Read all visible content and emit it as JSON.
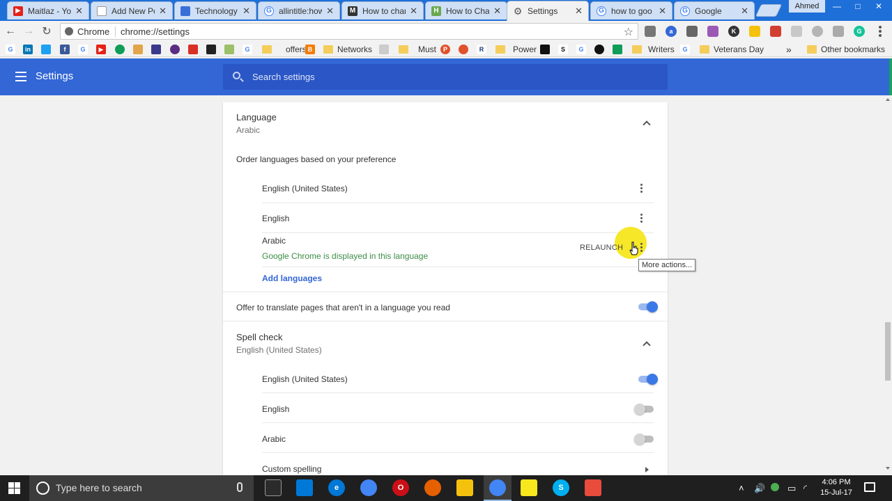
{
  "tabs": [
    {
      "title": "Maitlaz - Yo",
      "icon": "youtube-icon",
      "color": "#e62117"
    },
    {
      "title": "Add New Po",
      "icon": "page-icon",
      "color": "#9e9e9e"
    },
    {
      "title": "Technology",
      "icon": "blog-icon",
      "color": "#3a6fd8"
    },
    {
      "title": "allintitle:how",
      "icon": "google-icon",
      "color": "#4285f4"
    },
    {
      "title": "How to chan",
      "icon": "medium-icon",
      "color": "#333333"
    },
    {
      "title": "How to Chan",
      "icon": "site-icon",
      "color": "#6aa84f"
    },
    {
      "title": "Settings",
      "icon": "gear-icon",
      "color": "#555555"
    },
    {
      "title": "how to goo",
      "icon": "google-icon",
      "color": "#4285f4"
    },
    {
      "title": "Google",
      "icon": "google-icon",
      "color": "#4285f4"
    }
  ],
  "window": {
    "user": "Ahmed",
    "minimize": "—",
    "maximize": "□",
    "close": "✕"
  },
  "omnibox": {
    "scheme": "Chrome",
    "url": "chrome://settings"
  },
  "bookmarks": {
    "items": [
      "offers",
      "Networks",
      "Must",
      "Power",
      "Writers",
      "Veterans Day"
    ],
    "overflow": "»",
    "other": "Other bookmarks"
  },
  "header": {
    "title": "Settings",
    "search_placeholder": "Search settings"
  },
  "language": {
    "title": "Language",
    "current": "Arabic",
    "order_label": "Order languages based on your preference",
    "list": [
      {
        "name": "English (United States)"
      },
      {
        "name": "English"
      },
      {
        "name": "Arabic",
        "note": "Google Chrome is displayed in this language",
        "action": "RELAUNCH"
      }
    ],
    "add": "Add languages",
    "translate_label": "Offer to translate pages that aren't in a language you read",
    "translate_on": true
  },
  "spellcheck": {
    "title": "Spell check",
    "current": "English (United States)",
    "list": [
      {
        "name": "English (United States)",
        "on": true
      },
      {
        "name": "English",
        "on": false
      },
      {
        "name": "Arabic",
        "on": false
      }
    ],
    "custom": "Custom spelling"
  },
  "tooltip": "More actions...",
  "taskbar": {
    "search_placeholder": "Type here to search",
    "time": "4:06 PM",
    "date": "15-Jul-17"
  },
  "colors": {
    "header_blue": "#3367d6",
    "toggle_blue": "#3b78e7",
    "green_text": "#3c8d46",
    "highlight": "#f5e61c"
  }
}
